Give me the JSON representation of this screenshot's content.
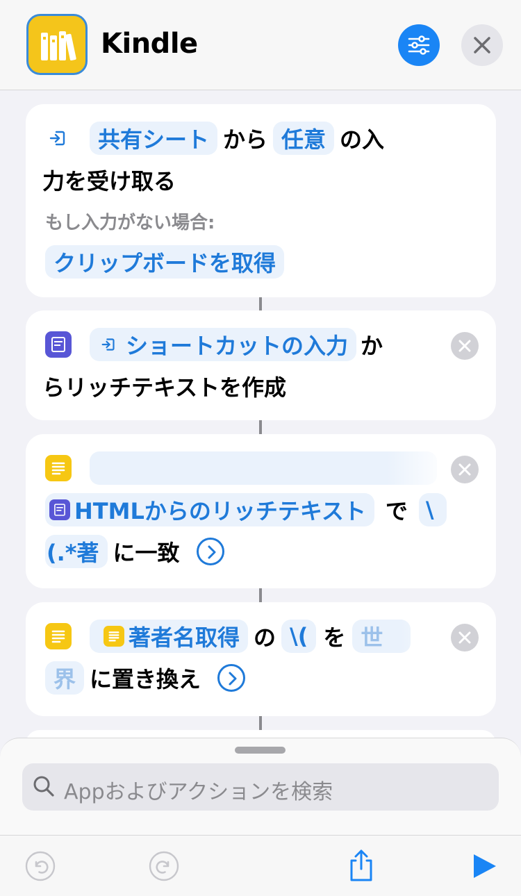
{
  "header": {
    "app_title": "Kindle",
    "icons": {
      "app": "books-icon",
      "settings": "sliders-icon",
      "close": "close-icon"
    }
  },
  "actions": [
    {
      "part1_pill1": "共有シート",
      "part1_text1": "から",
      "part1_pill2": "任意",
      "part1_text2": "の入",
      "line2": "力を受け取る",
      "sub_label": "もし入力がない場合:",
      "fallback_pill": "クリップボードを取得"
    },
    {
      "pill": "ショートカットの入力",
      "text1": "か",
      "line2": "らリッチテキストを作成"
    },
    {
      "pill1": "HTMLからのリッチテキスト",
      "text1": "で",
      "pill2_a": "\\",
      "pill2_b": "(.*著",
      "text2": "に一致"
    },
    {
      "pill1": "著者名取得",
      "text1": "の",
      "pill2": "\\(",
      "text2": "を",
      "pill3_a": "世",
      "pill3_b": "界",
      "text3": "に置き換え"
    }
  ],
  "search": {
    "placeholder": "Appおよびアクションを検索"
  },
  "toolbar": {
    "icons": [
      "undo-icon",
      "redo-icon",
      "share-icon",
      "play-icon"
    ]
  },
  "colors": {
    "accent": "#1f7ad9",
    "pill_bg": "#eaf2fc",
    "app_icon": "#f4c51b",
    "text_icon": "#f6c713",
    "rich_text_icon": "#5856d6"
  }
}
